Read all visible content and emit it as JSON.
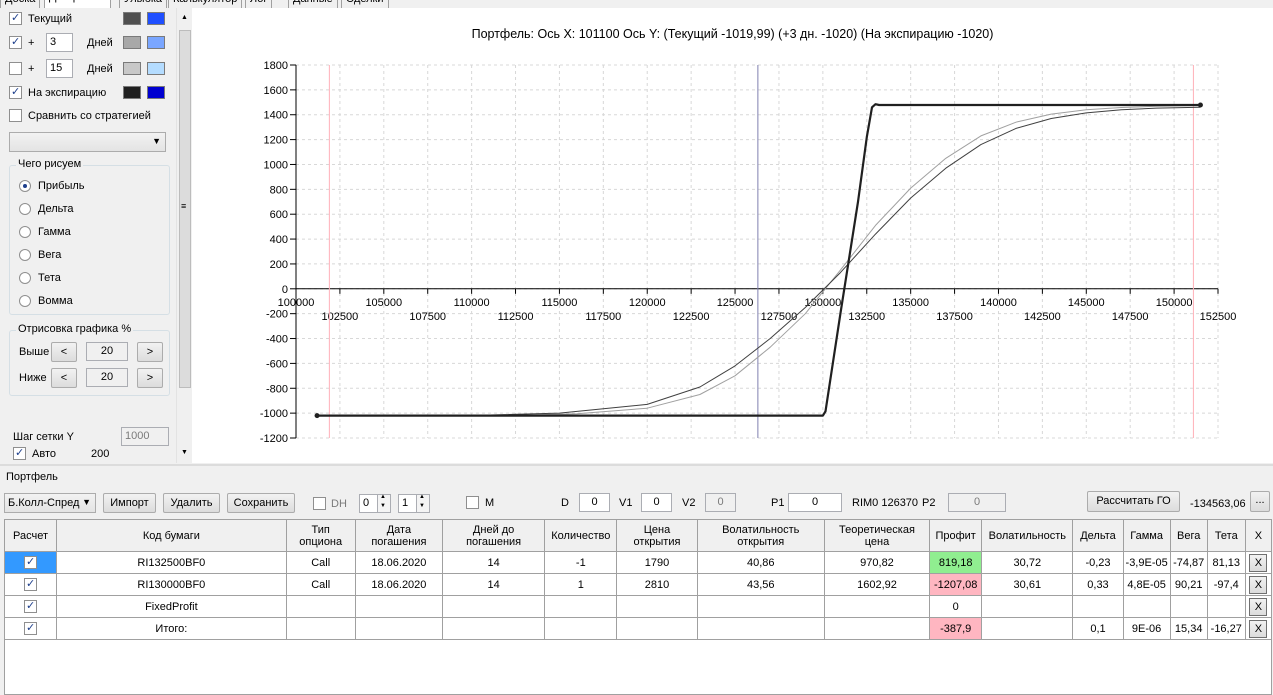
{
  "tabs": [
    {
      "label": "Доска",
      "left": 0
    },
    {
      "label": "Диаграмма",
      "active": true
    },
    {
      "label": "Улыбка"
    },
    {
      "label": "Калькулятор"
    },
    {
      "label": "Лог"
    },
    {
      "label": "Данные"
    },
    {
      "label": "Сделки"
    }
  ],
  "left": {
    "current_label": "Текущий",
    "plus": "+",
    "days1": "3",
    "days2": "15",
    "days_label": "Дней",
    "expiry_label": "На экспирацию",
    "compare_label": "Сравнить со стратегией",
    "what_group": "Чего рисуем",
    "radios": [
      "Прибыль",
      "Дельта",
      "Гамма",
      "Вега",
      "Тета",
      "Вомма"
    ],
    "draw_group": "Отрисовка графика %",
    "above_label": "Выше",
    "below_label": "Ниже",
    "above_val": "20",
    "below_val": "20",
    "btn_less": "<",
    "btn_more": ">",
    "grid_y_label": "Шаг сетки Y",
    "grid_y_val": "1000",
    "auto_label": "Авто",
    "auto_val": "200",
    "colors": {
      "current": [
        "#505050",
        "#1f4fff"
      ],
      "plus3": [
        "#a8a8a8",
        "#7aa6ff"
      ],
      "plus15": [
        "#c8c8c8",
        "#b4dcff"
      ],
      "expiry": [
        "#202020",
        "#0000d0"
      ]
    }
  },
  "chart": {
    "title": "Портфель: Ось Х:  101100  Ось Y:   (Текущий -1019,99)  (+3 дн. -1020)  (На экспирацию -1020)"
  },
  "chart_data": {
    "type": "line",
    "x_range": [
      100000,
      152500
    ],
    "y_range": [
      -1200,
      1800
    ],
    "y_ticks": [
      1800,
      1600,
      1400,
      1200,
      1000,
      800,
      600,
      400,
      200,
      0,
      -200,
      -400,
      -600,
      -800,
      -1000,
      -1200
    ],
    "x_ticks_upper": [
      100000,
      105000,
      110000,
      115000,
      120000,
      125000,
      130000,
      135000,
      140000,
      145000,
      150000
    ],
    "x_ticks_lower": [
      102500,
      107500,
      112500,
      117500,
      122500,
      127500,
      132500,
      137500,
      142500,
      147500,
      152500
    ],
    "vertical_lines": [
      {
        "x": 101900,
        "color": "#ffb0b8"
      },
      {
        "x": 126300,
        "color": "#8080b0"
      },
      {
        "x": 151100,
        "color": "#ffb0b8"
      }
    ],
    "series": [
      {
        "key": "expiry",
        "color": "#202020",
        "width": 2.2,
        "points": [
          [
            101200,
            -1020
          ],
          [
            130000,
            -1020
          ],
          [
            130150,
            -985
          ],
          [
            131000,
            -200
          ],
          [
            132000,
            700
          ],
          [
            132500,
            1220
          ],
          [
            132800,
            1460
          ],
          [
            133000,
            1485
          ],
          [
            133200,
            1478
          ],
          [
            151500,
            1478
          ]
        ]
      },
      {
        "key": "current",
        "color": "#404040",
        "width": 1,
        "points": [
          [
            101200,
            -1020
          ],
          [
            110000,
            -1019
          ],
          [
            115000,
            -1000
          ],
          [
            120000,
            -930
          ],
          [
            123000,
            -790
          ],
          [
            125000,
            -620
          ],
          [
            127000,
            -400
          ],
          [
            129000,
            -150
          ],
          [
            131000,
            130
          ],
          [
            133000,
            440
          ],
          [
            135000,
            730
          ],
          [
            137000,
            970
          ],
          [
            139000,
            1160
          ],
          [
            141000,
            1290
          ],
          [
            143000,
            1370
          ],
          [
            145000,
            1415
          ],
          [
            147000,
            1440
          ],
          [
            149000,
            1453
          ],
          [
            151500,
            1460
          ]
        ]
      },
      {
        "key": "plus3",
        "color": "#a0a0a0",
        "width": 1,
        "points": [
          [
            101200,
            -1020
          ],
          [
            112000,
            -1019
          ],
          [
            116000,
            -1005
          ],
          [
            120000,
            -960
          ],
          [
            123000,
            -850
          ],
          [
            125000,
            -700
          ],
          [
            127000,
            -470
          ],
          [
            129000,
            -200
          ],
          [
            131000,
            150
          ],
          [
            133000,
            510
          ],
          [
            135000,
            810
          ],
          [
            137000,
            1050
          ],
          [
            139000,
            1230
          ],
          [
            141000,
            1340
          ],
          [
            143000,
            1405
          ],
          [
            145000,
            1440
          ],
          [
            147000,
            1458
          ],
          [
            149000,
            1468
          ],
          [
            151500,
            1474
          ]
        ]
      }
    ],
    "markers": [
      [
        101200,
        -1020
      ],
      [
        151500,
        1478
      ]
    ]
  },
  "portfolio": {
    "label": "Портфель",
    "strategy": "Б.Колл-Спред",
    "import_btn": "Импорт",
    "delete_btn": "Удалить",
    "save_btn": "Сохранить",
    "dh_label": "DH",
    "spin1": "0",
    "spin2": "1",
    "m_label": "M",
    "d_label": "D",
    "d_val": "0",
    "v1_label": "V1",
    "v1_val": "0",
    "v2_label": "V2",
    "v2_val": "0",
    "p1_label": "P1",
    "p1_val": "0",
    "rim_label": "RIM0 126370",
    "p2_label": "P2",
    "p2_val": "0",
    "calc_btn": "Рассчитать ГО",
    "go_value": "-134563,06 ₽",
    "more_btn": "..."
  },
  "table": {
    "headers": [
      "Расчет",
      "Код бумаги",
      "Тип опциона",
      "Дата погашения",
      "Дней до погашения",
      "Количество",
      "Цена открытия",
      "Волатильность открытия",
      "Теоретическая цена",
      "Профит",
      "Волатильность",
      "Дельта",
      "Гамма",
      "Вега",
      "Тета",
      "X"
    ],
    "rows": [
      [
        "RI132500BF0",
        "Call",
        "18.06.2020",
        "14",
        "-1",
        "1790",
        "40,86",
        "970,82",
        "819,18",
        "30,72",
        "-0,23",
        "-3,9E-05",
        "-74,87",
        "81,13"
      ],
      [
        "RI130000BF0",
        "Call",
        "18.06.2020",
        "14",
        "1",
        "2810",
        "43,56",
        "1602,92",
        "-1207,08",
        "30,61",
        "0,33",
        "4,8E-05",
        "90,21",
        "-97,4"
      ],
      [
        "FixedProfit",
        "",
        "",
        "",
        "",
        "",
        "",
        "",
        "0",
        "",
        "",
        "",
        "",
        ""
      ],
      [
        "Итого:",
        "",
        "",
        "",
        "",
        "",
        "",
        "",
        "-387,9",
        "",
        "0,1",
        "9E-06",
        "15,34",
        "-16,27"
      ]
    ],
    "x_label": "X"
  }
}
